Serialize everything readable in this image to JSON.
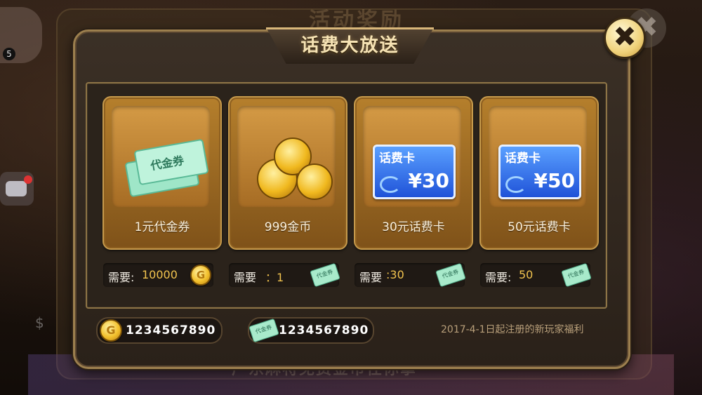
{
  "background": {
    "title_ghost": "活动奖励",
    "bottom_ghost": "广东麻将免费金币任你拿",
    "avatar_badge": "5",
    "dollar_glyph": "$"
  },
  "dialog": {
    "title": "话费大放送",
    "close_glyph": "✖"
  },
  "cards": [
    {
      "name": "1元代金券",
      "icon": "coupon-icon",
      "coupon_text": "代金券"
    },
    {
      "name": "999金币",
      "icon": "gold-coins-icon"
    },
    {
      "name": "30元话费卡",
      "icon": "phone-card-icon",
      "card_title": "话费卡",
      "card_amount": "¥30"
    },
    {
      "name": "50元话费卡",
      "icon": "phone-card-icon",
      "card_title": "话费卡",
      "card_amount": "¥50"
    }
  ],
  "requirements": [
    {
      "label": "需要:",
      "value": "10000",
      "currency_icon": "gold-coin-icon"
    },
    {
      "label": "需要",
      "value": "：1",
      "currency_icon": "coupon-ticket-icon"
    },
    {
      "label": "需要",
      "value": ":30",
      "currency_icon": "coupon-ticket-icon"
    },
    {
      "label": "需要:",
      "value": "50",
      "currency_icon": "coupon-ticket-icon"
    }
  ],
  "ticket_text": "代金券",
  "balances": {
    "gold": "1234567890",
    "coupons": "1234567890"
  },
  "footnote": "2017-4-1日起注册的新玩家福利",
  "colors": {
    "gold_value": "#f1c34e",
    "title": "#f6e3b4",
    "card_body": "#b57f2c",
    "phone_card": "#1f52d8"
  }
}
